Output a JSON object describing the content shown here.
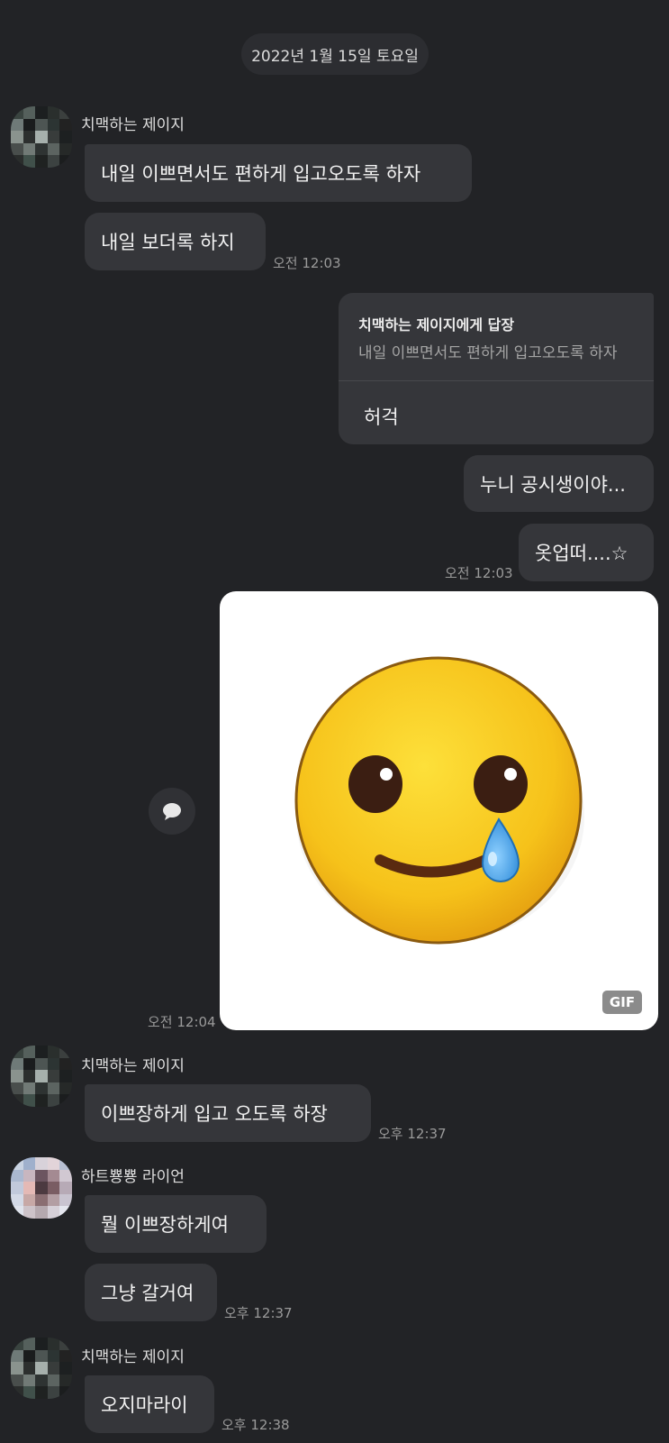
{
  "date_divider": "2022년 1월 15일 토요일",
  "colors": {
    "background": "#222326",
    "bubble": "#35363a",
    "date_pill": "#2c2d31",
    "emoji_face": "#f6c21a",
    "tear": "#4aa3e6"
  },
  "messages": [
    {
      "sender": "치맥하는 제이지",
      "texts": [
        "내일 이쁘면서도 편하게 입고오도록 하자",
        "내일 보더록 하지"
      ],
      "time": "오전 12:03"
    },
    {
      "sender": "me",
      "reply": {
        "header": "치맥하는 제이지에게 답장",
        "quote": "내일 이쁘면서도 편하게 입고오도록 하자",
        "text": "허걱"
      }
    },
    {
      "sender": "me",
      "texts": [
        "누니 공시생이야...",
        "옷업떠....☆"
      ],
      "time": "오전 12:03"
    },
    {
      "sender": "me",
      "gif": {
        "badge": "GIF",
        "icon": "smiling-face-with-tear-icon"
      },
      "time": "오전 12:04"
    },
    {
      "sender": "치맥하는 제이지",
      "texts": [
        "이쁘장하게 입고 오도록 하장"
      ],
      "time": "오후 12:37"
    },
    {
      "sender": "하트뿅뿅 라이언",
      "texts": [
        "뭘 이쁘장하게여",
        "그냥 갈거여"
      ],
      "time": "오후 12:37"
    },
    {
      "sender": "치맥하는 제이지",
      "texts": [
        "오지마라이"
      ],
      "time": "오후 12:38"
    }
  ],
  "icons": {
    "comment": "comment-bubble-icon",
    "avatar": "pixelated-avatar"
  }
}
